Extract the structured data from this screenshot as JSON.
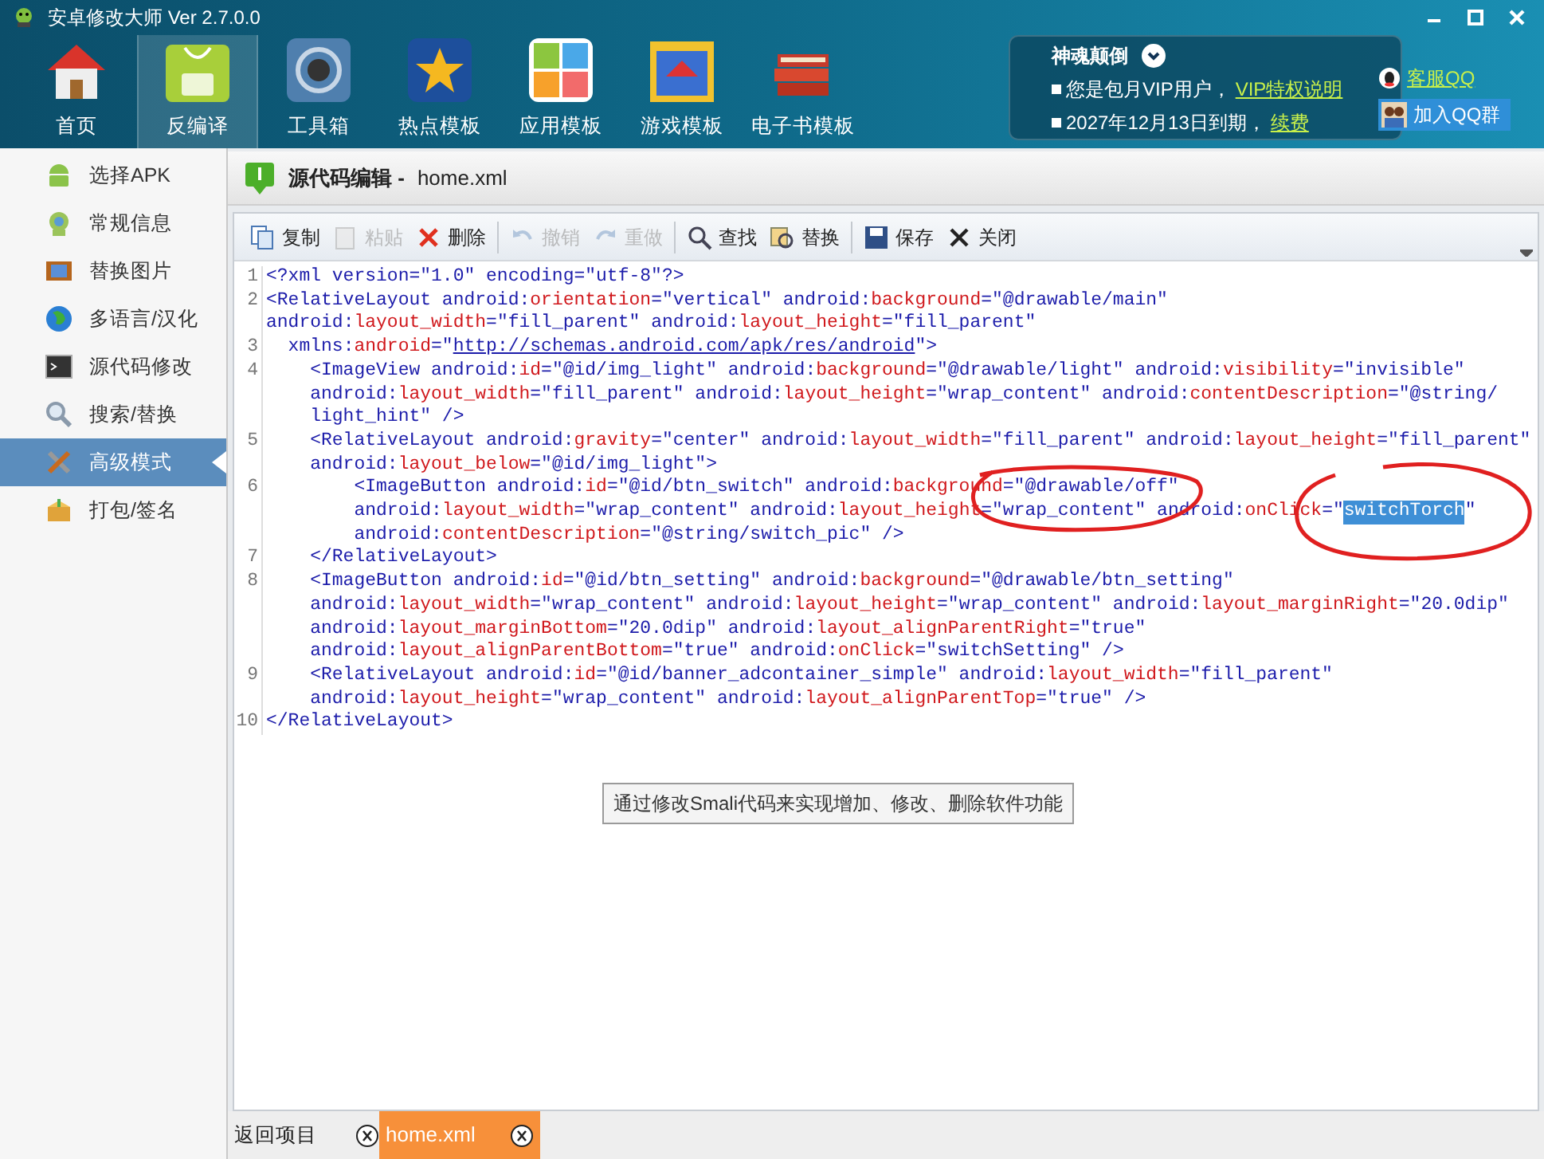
{
  "window": {
    "title": "安卓修改大师 Ver 2.7.0.0"
  },
  "nav": [
    {
      "label": "首页",
      "selected": false
    },
    {
      "label": "反编译",
      "selected": true
    },
    {
      "label": "工具箱",
      "selected": false
    },
    {
      "label": "热点模板",
      "selected": false
    },
    {
      "label": "应用模板",
      "selected": false
    },
    {
      "label": "游戏模板",
      "selected": false
    },
    {
      "label": "电子书模板",
      "selected": false
    }
  ],
  "account": {
    "name": "神魂颠倒",
    "lines": [
      {
        "text": "您是包月VIP用户，",
        "link": "VIP特权说明"
      },
      {
        "text": "2027年12月13日到期，",
        "link": "续费"
      }
    ],
    "service_link": "客服QQ",
    "join_button": "加入QQ群"
  },
  "sidebar": [
    {
      "label": "选择APK",
      "selected": false
    },
    {
      "label": "常规信息",
      "selected": false
    },
    {
      "label": "替换图片",
      "selected": false
    },
    {
      "label": "多语言/汉化",
      "selected": false
    },
    {
      "label": "源代码修改",
      "selected": false
    },
    {
      "label": "搜索/替换",
      "selected": false
    },
    {
      "label": "高级模式",
      "selected": true
    },
    {
      "label": "打包/签名",
      "selected": false
    }
  ],
  "editor": {
    "title": "源代码编辑 -",
    "file": "home.xml",
    "toolbar": [
      {
        "label": "复制",
        "disabled": false
      },
      {
        "label": "粘贴",
        "disabled": true
      },
      {
        "label": "删除",
        "disabled": false
      },
      {
        "label": "撤销",
        "disabled": true
      },
      {
        "label": "重做",
        "disabled": true
      },
      {
        "label": "查找",
        "disabled": false
      },
      {
        "label": "替换",
        "disabled": false
      },
      {
        "label": "保存",
        "disabled": false
      },
      {
        "label": "关闭",
        "disabled": false
      }
    ],
    "lines": [
      {
        "number": "1",
        "rows": [
          "<?xml version=\"1.0\" encoding=\"utf-8\"?>"
        ]
      },
      {
        "number": "2",
        "rows": [
          "<RelativeLayout android:orientation=\"vertical\" android:background=\"@drawable/main\"",
          "android:layout_width=\"fill_parent\" android:layout_height=\"fill_parent\""
        ]
      },
      {
        "number": "3",
        "rows": [
          "  xmlns:android=\"http://schemas.android.com/apk/res/android\">"
        ]
      },
      {
        "number": "4",
        "rows": [
          "    <ImageView android:id=\"@id/img_light\" android:background=\"@drawable/light\" android:visibility=\"invisible\"",
          "    android:layout_width=\"fill_parent\" android:layout_height=\"wrap_content\" android:contentDescription=\"@string/",
          "    light_hint\" />"
        ]
      },
      {
        "number": "5",
        "rows": [
          "    <RelativeLayout android:gravity=\"center\" android:layout_width=\"fill_parent\" android:layout_height=\"fill_parent\"",
          "    android:layout_below=\"@id/img_light\">"
        ]
      },
      {
        "number": "6",
        "rows": [
          "        <ImageButton android:id=\"@id/btn_switch\" android:background=\"@drawable/off\"",
          [
            {
              "text": "        android:layout_width=\"wrap_content\" android:layout_height=\"wrap_content\" android:onClick=\"",
              "selected": false
            },
            {
              "text": "switchTorch",
              "selected": true
            },
            {
              "text": "\"",
              "selected": false
            }
          ],
          "        android:contentDescription=\"@string/switch_pic\" />"
        ]
      },
      {
        "number": "7",
        "rows": [
          "    </RelativeLayout>"
        ]
      },
      {
        "number": "8",
        "rows": [
          "    <ImageButton android:id=\"@id/btn_setting\" android:background=\"@drawable/btn_setting\"",
          "    android:layout_width=\"wrap_content\" android:layout_height=\"wrap_content\" android:layout_marginRight=\"20.0dip\"",
          "    android:layout_marginBottom=\"20.0dip\" android:layout_alignParentRight=\"true\"",
          "    android:layout_alignParentBottom=\"true\" android:onClick=\"switchSetting\" />"
        ]
      },
      {
        "number": "9",
        "rows": [
          "    <RelativeLayout android:id=\"@id/banner_adcontainer_simple\" android:layout_width=\"fill_parent\"",
          "    android:layout_height=\"wrap_content\" android:layout_alignParentTop=\"true\" />"
        ]
      },
      {
        "number": "10",
        "rows": [
          "</RelativeLayout>"
        ]
      }
    ]
  },
  "tooltip": "通过修改Smali代码来实现增加、修改、删除软件功能",
  "bottom_bar": {
    "back": "返回项目",
    "tabs": [
      {
        "label": "home.xml",
        "selected": true
      }
    ]
  }
}
